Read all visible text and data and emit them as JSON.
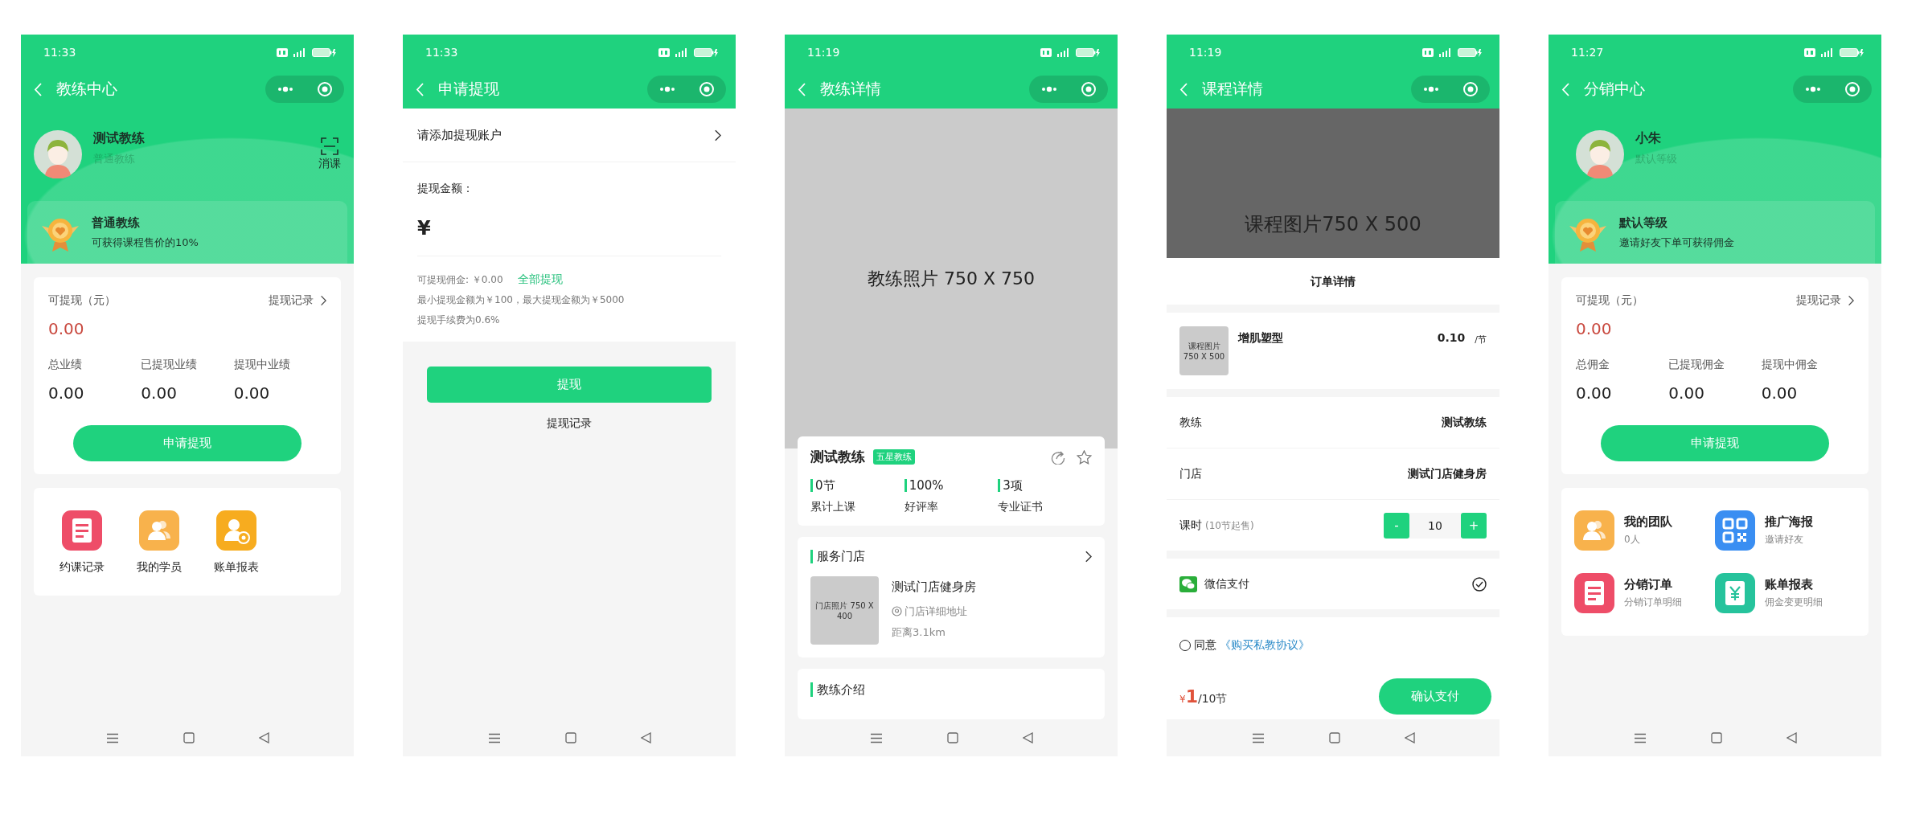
{
  "phones": [
    {
      "kind": "center",
      "time": "11:33",
      "title": "教练中心",
      "profile": {
        "name": "测试教练",
        "level": "普通教练",
        "scan_label": "消课"
      },
      "level_card": {
        "title": "普通教练",
        "desc": "可获得课程售价的10%"
      },
      "balance": {
        "label": "可提现（元）",
        "link": "提现记录",
        "amount": "0.00"
      },
      "stats": [
        {
          "label": "总业绩",
          "value": "0.00"
        },
        {
          "label": "已提现业绩",
          "value": "0.00"
        },
        {
          "label": "提现中业绩",
          "value": "0.00"
        }
      ],
      "button": "申请提现",
      "menu": [
        {
          "kind": "document",
          "label": "约课记录",
          "color": "#ee4d68"
        },
        {
          "kind": "people",
          "label": "我的学员",
          "color": "#f8b24c"
        },
        {
          "kind": "person-badge",
          "label": "账单报表",
          "color": "#f7ac1f"
        }
      ]
    },
    {
      "kind": "withdraw",
      "time": "11:33",
      "title": "申请提现",
      "account_row": "请添加提现账户",
      "amount_label": "提现金额：",
      "currency": "¥",
      "available": "可提现佣金: ￥0.00",
      "withdraw_all": "全部提现",
      "limits": "最小提现金额为￥100，最大提现金额为￥5000",
      "fee": "提现手续费为0.6%",
      "button": "提现",
      "record_link": "提现记录"
    },
    {
      "kind": "coach_detail",
      "time": "11:19",
      "title": "教练详情",
      "photo_placeholder": "教练照片 750 X 750",
      "coach": {
        "name": "测试教练",
        "badge": "五星教练",
        "favorited": false
      },
      "stats": [
        {
          "value": "0节",
          "label": "累计上课"
        },
        {
          "value": "100%",
          "label": "好评率"
        },
        {
          "value": "3项",
          "label": "专业证书"
        }
      ],
      "store_section": {
        "heading": "服务门店",
        "thumb": "门店照片 750 X 400",
        "name": "测试门店健身房",
        "address": "门店详细地址",
        "distance": "距离3.1km"
      },
      "intro_heading": "教练介绍"
    },
    {
      "kind": "course_detail",
      "time": "11:19",
      "title": "课程详情",
      "image_placeholder": "课程图片750 X 500",
      "order_heading": "订单详情",
      "product": {
        "thumb": "课程图片750 X 500",
        "name": "增肌塑型",
        "price": "0.10",
        "unit": "/节"
      },
      "rows": [
        {
          "label": "教练",
          "value": "测试教练"
        },
        {
          "label": "门店",
          "value": "测试门店健身房"
        }
      ],
      "hours": {
        "label": "课时",
        "note": "(10节起售)",
        "minus": "-",
        "quantity": "10",
        "plus": "+"
      },
      "payment": {
        "label": "微信支付",
        "selected": true
      },
      "agreement": {
        "prefix": "同意",
        "link": "《购买私教协议》",
        "checked": false
      },
      "total": {
        "currency": "¥",
        "amount": "1",
        "unit": "/10节"
      },
      "button": "确认支付"
    },
    {
      "kind": "center",
      "time": "11:27",
      "title": "分销中心",
      "profile": {
        "name": "小朱",
        "level": "默认等级"
      },
      "level_card": {
        "title": "默认等级",
        "desc": "邀请好友下单可获得佣金"
      },
      "balance": {
        "label": "可提现（元）",
        "link": "提现记录",
        "amount": "0.00"
      },
      "stats": [
        {
          "label": "总佣金",
          "value": "0.00"
        },
        {
          "label": "已提现佣金",
          "value": "0.00"
        },
        {
          "label": "提现中佣金",
          "value": "0.00"
        }
      ],
      "button": "申请提现",
      "menu": [
        {
          "kind": "people",
          "label": "我的团队",
          "subtitle": "0人",
          "color": "#f8b24c"
        },
        {
          "kind": "qr",
          "label": "推广海报",
          "subtitle": "邀请好友",
          "color": "#3a8ef2"
        },
        {
          "kind": "document",
          "label": "分销订单",
          "subtitle": "分销订单明细",
          "color": "#ee4d68"
        },
        {
          "kind": "ledger",
          "label": "账单报表",
          "subtitle": "佣金变更明细",
          "color": "#26c39c"
        }
      ]
    }
  ]
}
